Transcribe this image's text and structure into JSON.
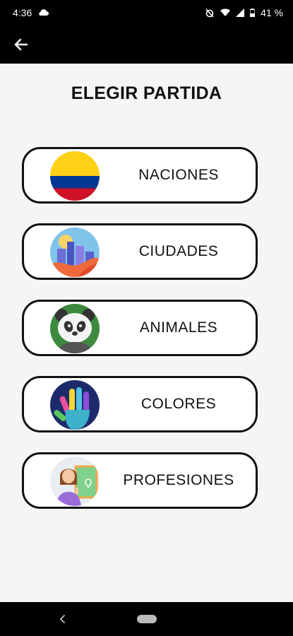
{
  "status_bar": {
    "time": "4:36",
    "battery": "41 %",
    "icons": [
      "cloud-icon",
      "alarm-off-icon",
      "wifi-icon",
      "signal-icon",
      "battery-icon"
    ]
  },
  "app_bar": {
    "back_icon": "arrow-left-icon"
  },
  "page": {
    "title": "ELEGIR PARTIDA"
  },
  "games": [
    {
      "label": "NACIONES",
      "icon": "colombia-flag-icon"
    },
    {
      "label": "CIUDADES",
      "icon": "city-skyline-icon"
    },
    {
      "label": "ANIMALES",
      "icon": "panda-icon"
    },
    {
      "label": "COLORES",
      "icon": "painted-hand-icon"
    },
    {
      "label": "PROFESIONES",
      "icon": "teacher-icon"
    }
  ],
  "nav_bar": {
    "back_icon": "chevron-left-icon",
    "home_icon": "home-pill-icon"
  }
}
